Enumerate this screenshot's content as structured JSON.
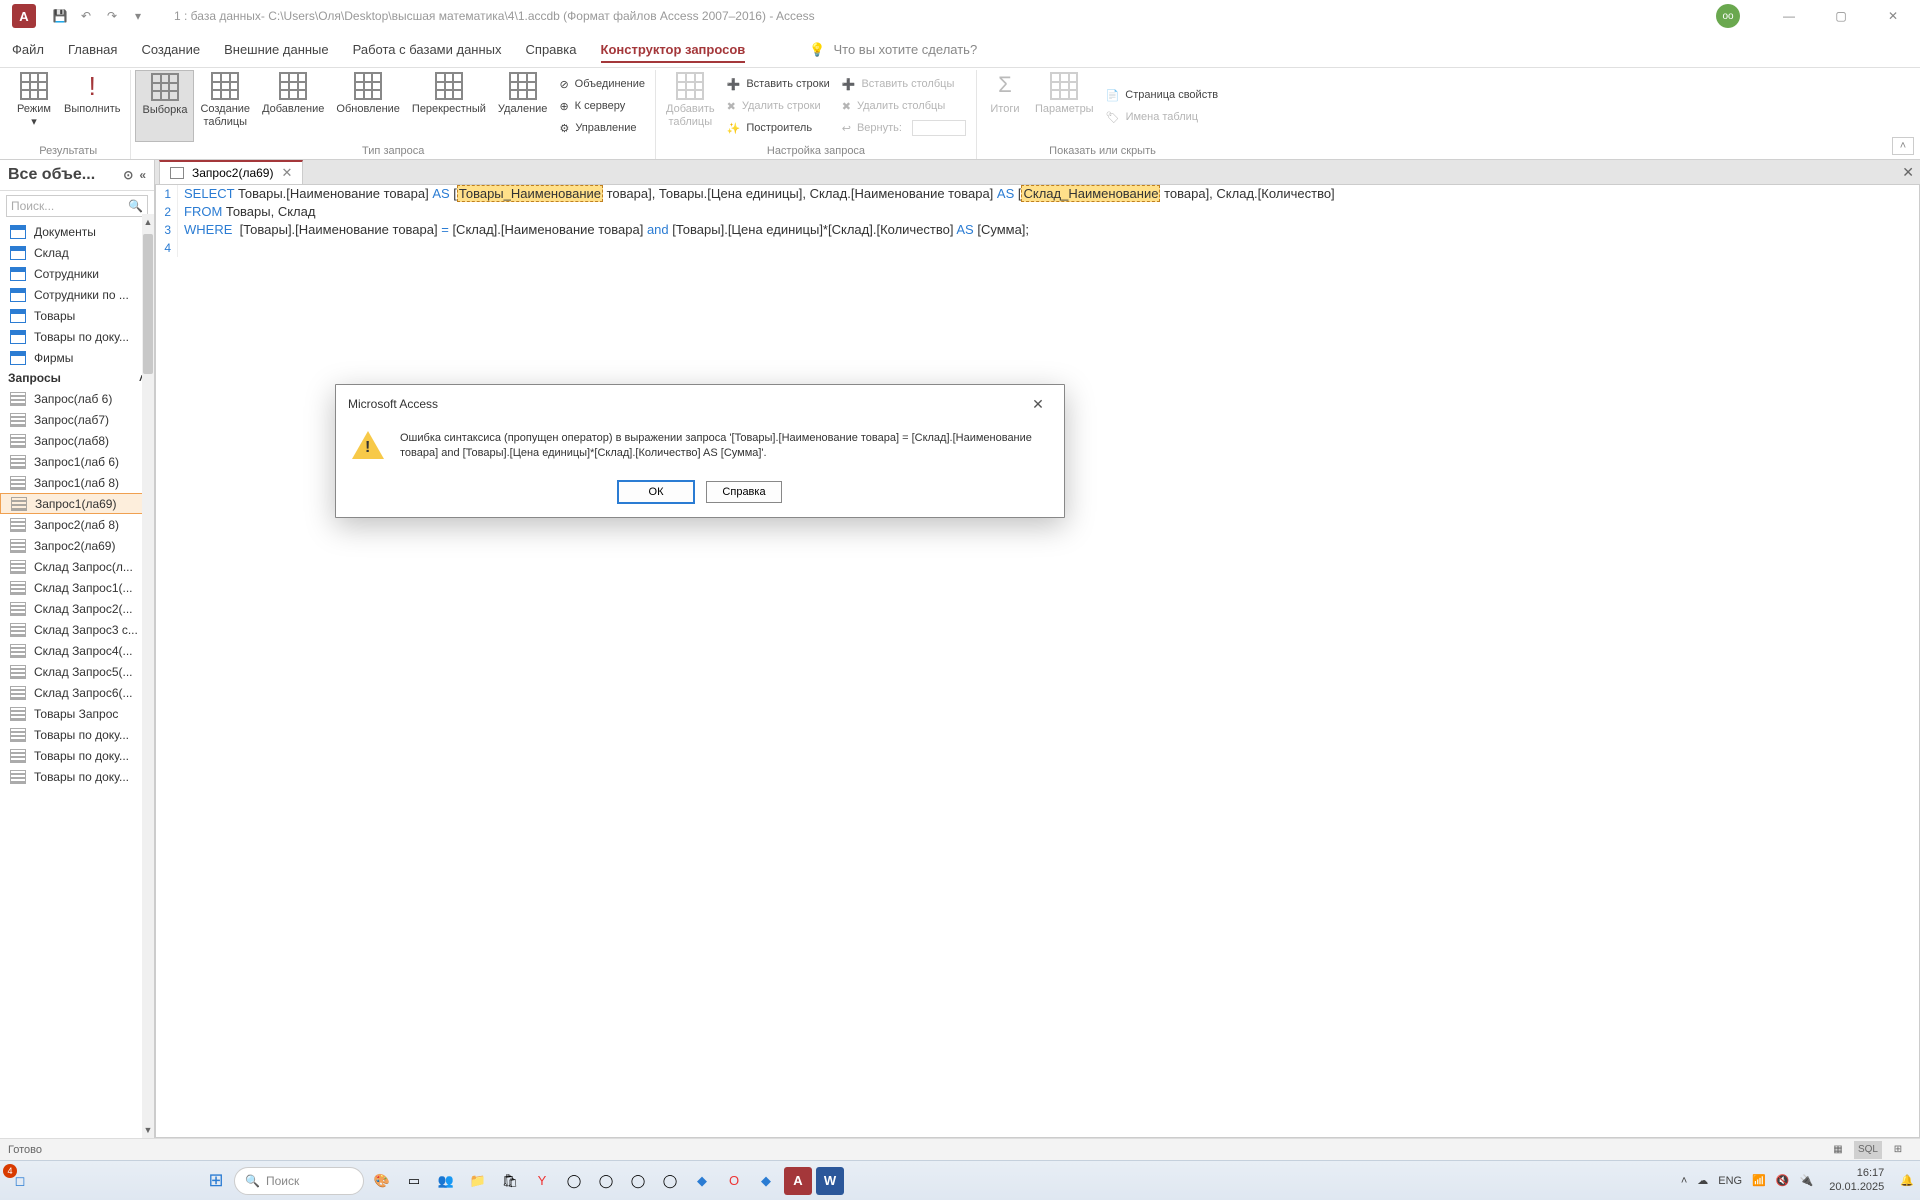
{
  "titlebar": {
    "app_letter": "A",
    "title": "1 : база данных- C:\\Users\\Оля\\Desktop\\высшая математика\\4\\1.accdb (Формат файлов Access 2007–2016)  -  Access",
    "avatar": "оо"
  },
  "tabs": {
    "file": "Файл",
    "home": "Главная",
    "create": "Создание",
    "external": "Внешние данные",
    "db": "Работа с базами данных",
    "help": "Справка",
    "designer": "Конструктор запросов",
    "search_placeholder": "Что вы хотите сделать?"
  },
  "ribbon": {
    "results": {
      "view": "Режим",
      "run": "Выполнить",
      "group": "Результаты"
    },
    "qtype": {
      "select": "Выборка",
      "maketable": "Создание\nтаблицы",
      "append": "Добавление",
      "update": "Обновление",
      "crosstab": "Перекрестный",
      "delete": "Удаление",
      "union": "Объединение",
      "passthrough": "К серверу",
      "ddl": "Управление",
      "group": "Тип запроса"
    },
    "setup": {
      "addtable": "Добавить\nтаблицы",
      "insrows": "Вставить строки",
      "delrows": "Удалить строки",
      "builder": "Построитель",
      "inscols": "Вставить столбцы",
      "delcols": "Удалить столбцы",
      "return": "Вернуть:",
      "group": "Настройка запроса"
    },
    "show": {
      "totals": "Итоги",
      "params": "Параметры",
      "propsheet": "Страница свойств",
      "tablenames": "Имена таблиц",
      "group": "Показать или скрыть"
    }
  },
  "nav": {
    "header": "Все объе...",
    "search": "Поиск...",
    "cat_queries": "Запросы",
    "tables": [
      "Документы",
      "Склад",
      "Сотрудники",
      "Сотрудники по ...",
      "Товары",
      "Товары по доку...",
      "Фирмы"
    ],
    "queries": [
      "Запрос(лаб 6)",
      "Запрос(лаб7)",
      "Запрос(лаб8)",
      "Запрос1(лаб 6)",
      "Запрос1(лаб 8)",
      "Запрос1(ла69)",
      "Запрос2(лаб 8)",
      "Запрос2(ла69)",
      "Склад Запрос(л...",
      "Склад Запрос1(...",
      "Склад Запрос2(...",
      "Склад Запрос3 с...",
      "Склад Запрос4(...",
      "Склад Запрос5(...",
      "Склад Запрос6(...",
      "Товары Запрос",
      "Товары по доку...",
      "Товары по доку...",
      "Товары по доку..."
    ],
    "selected_index": 5
  },
  "doc": {
    "tab_name": "Запрос2(ла69)",
    "sql1a": "SELECT",
    "sql1b": " Товары.[Наименование товара] ",
    "sql1c": "AS",
    "sql1d": " [",
    "sql1e": "Товары_Наименование",
    "sql1f": " товара], Товары.[Цена единицы], Склад.[Наименование товара] ",
    "sql1g": "AS",
    "sql1h": " [",
    "sql1i": "Склад_Наименование",
    "sql1j": " товара], Склад.[Количество]",
    "sql2a": "FROM",
    "sql2b": " Товары, Склад",
    "sql3a": "WHERE",
    "sql3b": "  [Товары].[Наименование товара] ",
    "sql3c": "=",
    "sql3d": " [Склад].[Наименование товара] ",
    "sql3e": "and",
    "sql3f": " [Товары].[Цена единицы]*[Склад].[Количество] ",
    "sql3g": "AS",
    "sql3h": " [Сумма];"
  },
  "dialog": {
    "title": "Microsoft Access",
    "message": "Ошибка синтаксиса (пропущен оператор) в выражении запроса '[Товары].[Наименование товара] = [Склад].[Наименование товара] and [Товары].[Цена единицы]*[Склад].[Количество] AS [Сумма]'.",
    "ok": "ОК",
    "help": "Справка"
  },
  "status": {
    "ready": "Готово",
    "sql": "SQL"
  },
  "taskbar": {
    "search": "Поиск",
    "lang": "ENG",
    "time": "16:17",
    "date": "20.01.2025",
    "badge": "4"
  }
}
